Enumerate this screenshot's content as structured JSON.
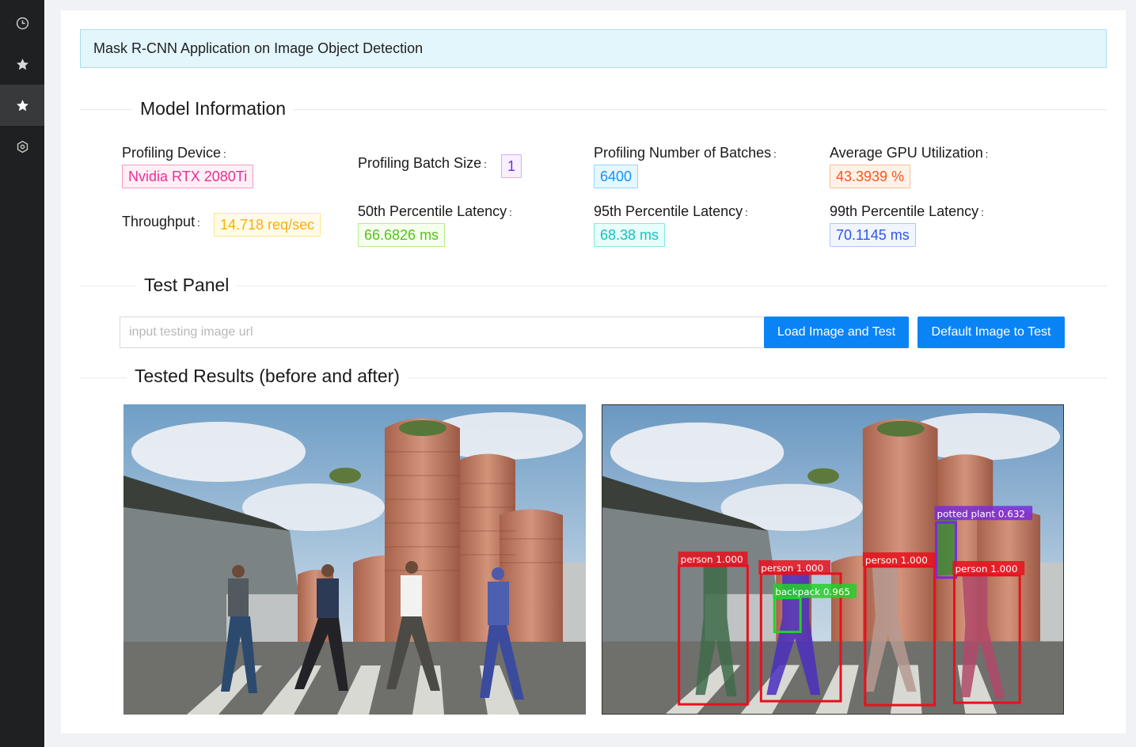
{
  "nav": {
    "items": [
      {
        "icon": "clock-icon",
        "active": false
      },
      {
        "icon": "star-icon",
        "active": false
      },
      {
        "icon": "star-icon",
        "active": true
      },
      {
        "icon": "hexagon-icon",
        "active": false
      }
    ]
  },
  "header": {
    "title": "Mask R-CNN Application on Image Object Detection"
  },
  "model_info": {
    "section_title": "Model Information",
    "profiling_device": {
      "label": "Profiling Device",
      "value": "Nvidia RTX 2080Ti"
    },
    "batch_size": {
      "label": "Profiling Batch Size",
      "value": "1"
    },
    "num_batches": {
      "label": "Profiling Number of Batches",
      "value": "6400"
    },
    "gpu_util": {
      "label": "Average GPU Utilization",
      "value": "43.3939 %"
    },
    "throughput": {
      "label": "Throughput",
      "value": "14.718 req/sec"
    },
    "p50": {
      "label": "50th Percentile Latency",
      "value": "66.6826 ms"
    },
    "p95": {
      "label": "95th Percentile Latency",
      "value": "68.38 ms"
    },
    "p99": {
      "label": "99th Percentile Latency",
      "value": "70.1145 ms"
    },
    "colon": ":"
  },
  "test_panel": {
    "section_title": "Test Panel",
    "url_placeholder": "input testing image url",
    "url_value": "",
    "load_button": "Load Image and Test",
    "default_button": "Default Image to Test"
  },
  "results": {
    "section_title": "Tested Results (before and after)",
    "detections": [
      {
        "label": "person 1.000",
        "color": "#e8101c"
      },
      {
        "label": "person 1.000",
        "color": "#e8101c"
      },
      {
        "label": "backpack 0.965",
        "color": "#22d12a"
      },
      {
        "label": "person 1.000",
        "color": "#e8101c"
      },
      {
        "label": "potted plant 0.632",
        "color": "#7a2bd9"
      },
      {
        "label": "person 1.000",
        "color": "#e8101c"
      }
    ]
  }
}
